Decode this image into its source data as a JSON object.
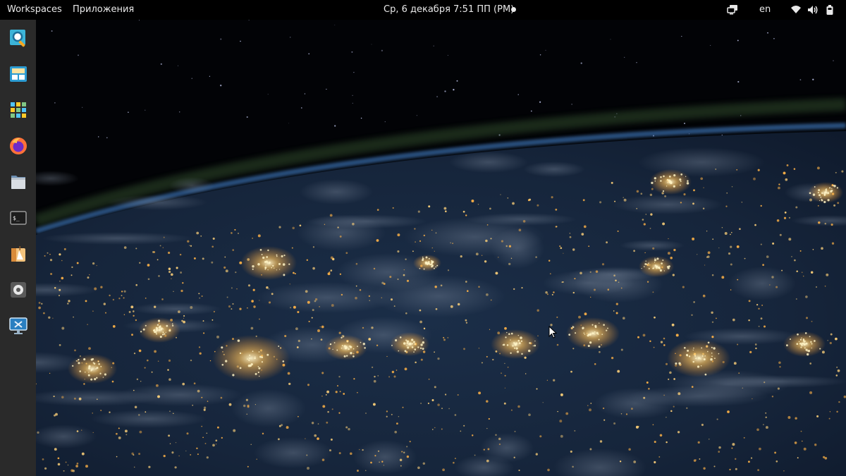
{
  "topbar": {
    "workspaces": "Workspaces",
    "applications": "Приложения",
    "clock": "Ср, 6 декабря   7:51 ПП (PM)",
    "lang": "en",
    "tray_icons": [
      "screen-share-icon",
      "wifi-icon",
      "volume-icon",
      "battery-icon"
    ]
  },
  "dock": {
    "items": [
      "search-app",
      "workspace-view",
      "app-grid",
      "firefox",
      "files",
      "terminal",
      "installer",
      "settings",
      "remote-desktop"
    ]
  },
  "colors": {
    "panel": "#000000",
    "dock": "#2a2a2a",
    "city_lights": "#ffcf6e",
    "ocean": "#162a45"
  }
}
